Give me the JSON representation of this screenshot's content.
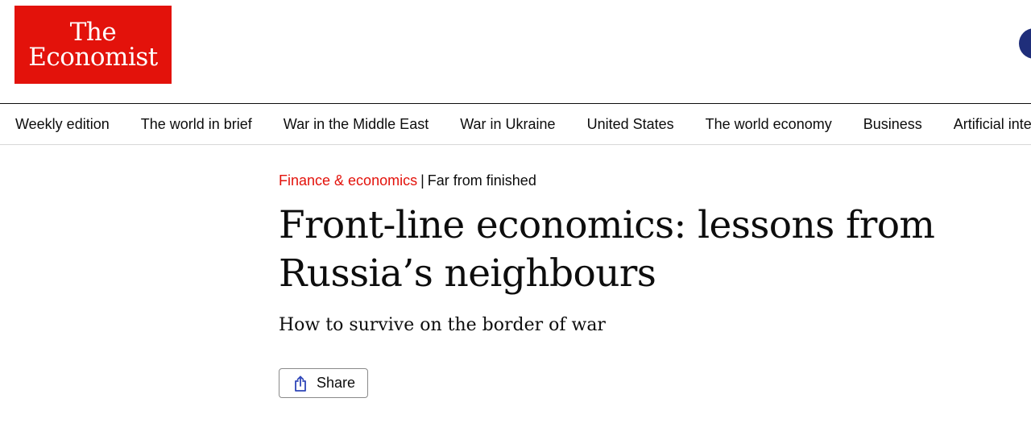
{
  "header": {
    "logo": {
      "line1": "The",
      "line2": "Economist"
    }
  },
  "nav": {
    "items": [
      {
        "label": "Weekly edition"
      },
      {
        "label": "The world in brief"
      },
      {
        "label": "War in the Middle East"
      },
      {
        "label": "War in Ukraine"
      },
      {
        "label": "United States"
      },
      {
        "label": "The world economy"
      },
      {
        "label": "Business"
      },
      {
        "label": "Artificial intelligence"
      }
    ]
  },
  "article": {
    "section": "Finance & economics",
    "separator": "|",
    "flytitle": "Far from finished",
    "headline": "Front-line economics: lessons from Russia’s neighbours",
    "standfirst": "How to survive on the border of war",
    "share_label": "Share"
  },
  "colors": {
    "brand_red": "#e3120b",
    "account_blue": "#1f2e7a",
    "share_icon_blue": "#2e45b8"
  },
  "icons": {
    "share": "share-icon",
    "account": "account-icon"
  }
}
